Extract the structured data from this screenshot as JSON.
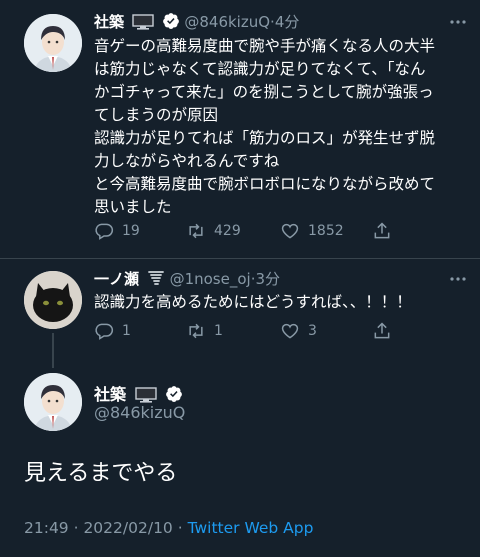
{
  "tweets": [
    {
      "name": "社築",
      "name_emoji": "monitor-icon",
      "verified": true,
      "handle": "@846kizuQ",
      "time": "4分",
      "text": "音ゲーの高難易度曲で腕や手が痛くなる人の大半\nは筋力じゃなくて認識力が足りてなくて、「なん\nかゴチャって来た」のを捌こうとして腕が強張っ\nてしまうのが原因\n認識力が足りてれば「筋力のロス」が発生せず脱\n力しながらやれるんですね\nと今高難易度曲で腕ボロボロになりながら改めて\n思いました",
      "replies": "19",
      "retweets": "429",
      "likes": "1852"
    },
    {
      "name": "一ノ瀬",
      "name_emoji": "tornado-icon",
      "handle": "@1nose_oj",
      "time": "3分",
      "text": "認識力を高めるためにはどうすれば、、！！！",
      "replies": "1",
      "retweets": "1",
      "likes": "3"
    }
  ],
  "main": {
    "name": "社築",
    "name_emoji": "monitor-icon",
    "verified": true,
    "handle": "@846kizuQ",
    "text": "見えるまでやる",
    "timestamp": "21:49 · 2022/02/10 · ",
    "app": "Twitter Web App"
  },
  "colors": {
    "background": "#15202b",
    "muted": "#8899a6",
    "accent": "#1d9bf0",
    "divider": "#38444d"
  }
}
